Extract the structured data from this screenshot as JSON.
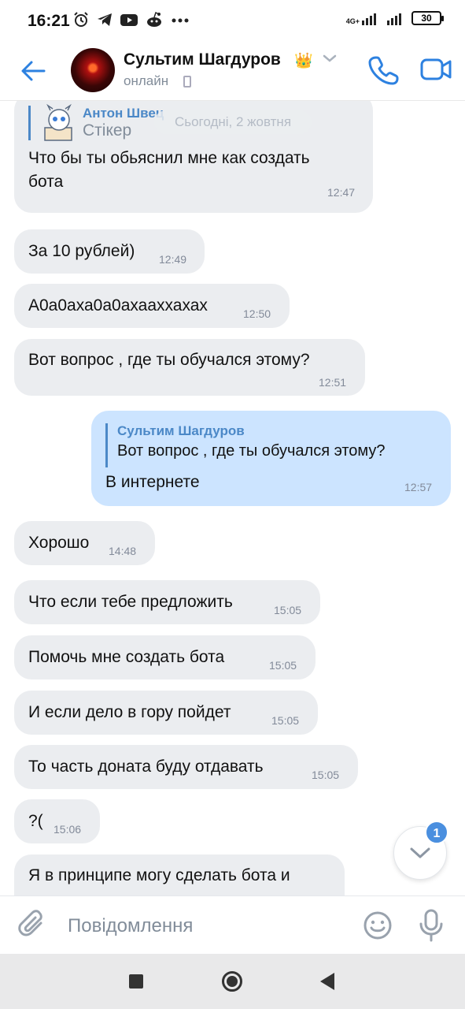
{
  "status_bar": {
    "time": "16:21",
    "network": "4G+",
    "battery": "30"
  },
  "header": {
    "contact_name": "Сультим Шагдуров",
    "crown": "👑",
    "status": "онлайн"
  },
  "chat": {
    "date_label": "Сьогодні, 2 жовтня",
    "messages": [
      {
        "reply_author": "Антон Швец",
        "reply_text": "Стікер",
        "text": "Что бы ты обьяснил мне как создать",
        "text2": "бота",
        "time": "12:47"
      },
      {
        "text": "За 10 рублей)",
        "time": "12:49"
      },
      {
        "text": "А0а0аха0а0ахааххахах",
        "time": "12:50"
      },
      {
        "text": "Вот вопрос , где ты обучался этому?",
        "time": "12:51"
      },
      {
        "reply_author": "Сультим Шагдуров",
        "reply_text": "Вот вопрос , где ты обучался этому?",
        "text": "В интернете",
        "time": "12:57"
      },
      {
        "text": "Хорошо",
        "time": "14:48"
      },
      {
        "text": "Что если тебе предложить",
        "time": "15:05"
      },
      {
        "text": "Помочь мне создать бота",
        "time": "15:05"
      },
      {
        "text": "И если дело в гору пойдет",
        "time": "15:05"
      },
      {
        "text": "То часть доната буду отдавать",
        "time": "15:05"
      },
      {
        "text": "?(",
        "time": "15:06"
      },
      {
        "text": "Я в принципе могу сделать бота и",
        "time": ""
      }
    ],
    "unread_count": "1"
  },
  "composer": {
    "placeholder": "Повідомлення"
  },
  "colors": {
    "accent": "#2d81e0",
    "incoming_bubble": "#ebedf0",
    "outgoing_bubble": "#cce4ff",
    "badge": "#4a8fdf"
  },
  "icons": {
    "back": "arrow-left-icon",
    "call": "phone-icon",
    "video": "video-camera-icon",
    "attach": "paperclip-icon",
    "emoji": "smile-icon",
    "mic": "microphone-icon",
    "scroll": "chevron-down-icon"
  }
}
